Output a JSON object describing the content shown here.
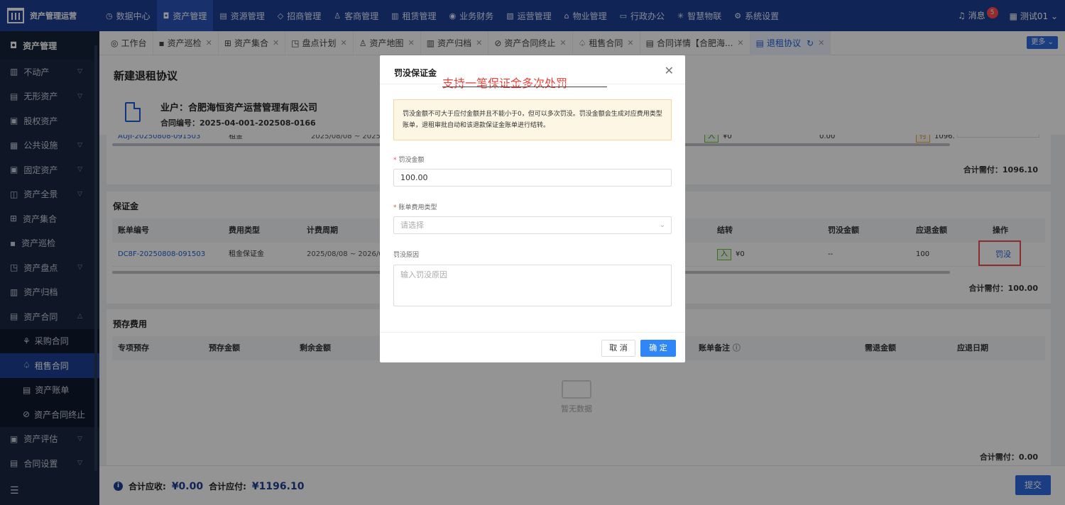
{
  "topbar": {
    "app_name": "资产管理运营",
    "nav": [
      {
        "label": "数据中心",
        "icon": "clock-icon"
      },
      {
        "label": "资产管理",
        "icon": "cube-icon"
      },
      {
        "label": "资源管理",
        "icon": "file-icon"
      },
      {
        "label": "招商管理",
        "icon": "diamond-icon"
      },
      {
        "label": "客商管理",
        "icon": "people-icon"
      },
      {
        "label": "租赁管理",
        "icon": "building-icon"
      },
      {
        "label": "业务财务",
        "icon": "money-icon"
      },
      {
        "label": "运营管理",
        "icon": "chart-icon"
      },
      {
        "label": "物业管理",
        "icon": "house-icon"
      },
      {
        "label": "行政办公",
        "icon": "monitor-icon"
      },
      {
        "label": "智慧物联",
        "icon": "iot-icon"
      },
      {
        "label": "系统设置",
        "icon": "gear-icon"
      }
    ],
    "messages_label": "消息",
    "messages_count": "5",
    "user": "测试01"
  },
  "sidebar": {
    "header": "资产管理",
    "items": [
      {
        "label": "不动产"
      },
      {
        "label": "无形资产"
      },
      {
        "label": "股权资产"
      },
      {
        "label": "公共设施"
      },
      {
        "label": "固定资产"
      },
      {
        "label": "资产全景"
      },
      {
        "label": "资产集合"
      },
      {
        "label": "资产巡检"
      },
      {
        "label": "资产盘点"
      },
      {
        "label": "资产归档"
      },
      {
        "label": "资产合同"
      }
    ],
    "sub_items": [
      {
        "label": "采购合同"
      },
      {
        "label": "租售合同"
      },
      {
        "label": "资产账单"
      },
      {
        "label": "资产合同终止"
      }
    ],
    "after_items": [
      {
        "label": "资产评估"
      },
      {
        "label": "合同设置"
      }
    ]
  },
  "tabs": [
    {
      "label": "工作台"
    },
    {
      "label": "资产巡检"
    },
    {
      "label": "资产集合"
    },
    {
      "label": "盘点计划"
    },
    {
      "label": "资产地图"
    },
    {
      "label": "资产归档"
    },
    {
      "label": "资产合同终止"
    },
    {
      "label": "租售合同"
    },
    {
      "label": "合同详情【合肥海..."
    },
    {
      "label": "退租协议"
    }
  ],
  "more_label": "更多",
  "page": {
    "title": "新建退租协议",
    "owner": "业户：合肥海恒资产运营管理有限公司",
    "contract_no": "合同编号：2025-04-001-202508-0166"
  },
  "rent_partial": {
    "bill_no": "AUJI-20250808-091503",
    "fee_type": "租金",
    "period": "2025/08/08 ~ 2025/1",
    "carry": "¥0",
    "amount": "0.00",
    "tag": "付",
    "due_partial": "1096.",
    "date": "2025-08-08",
    "total": "合计需付：1096.10"
  },
  "deposit": {
    "title": "保证金",
    "headers": [
      "账单编号",
      "费用类型",
      "计费周期",
      "结转",
      "罚没金额",
      "应退金额",
      "操作"
    ],
    "row": {
      "bill_no": "DC8F-20250808-091503",
      "fee_type": "租金保证金",
      "period": "2025/08/08 ~ 2026/08/07",
      "carry_tag": "入",
      "carry": "¥0",
      "forfeit": "--",
      "refund": "100",
      "action": "罚没"
    },
    "total": "合计需付：100.00"
  },
  "prestore": {
    "title": "预存费用",
    "headers": [
      "专项预存",
      "预存金额",
      "剩余金额",
      "账单备注",
      "需退金额",
      "应退日期"
    ],
    "empty": "暂无数据",
    "total": "合计需付：0.00"
  },
  "footer": {
    "receivable_label": "合计应收:",
    "receivable": "¥0.00",
    "payable_label": "合计应付:",
    "payable": "¥1196.10",
    "submit": "提交"
  },
  "modal": {
    "title": "罚没保证金",
    "annotation": "支持一笔保证金多次处罚",
    "notice": "罚没金额不可大于应付金额并且不能小于0，但可以多次罚没。罚没金额会生成对应费用类型账单，退租审批自动和该退款保证金账单进行结转。",
    "amount_label": "罚没金额",
    "amount_value": "100.00",
    "type_label": "账单费用类型",
    "type_placeholder": "请选择",
    "reason_label": "罚没原因",
    "reason_placeholder": "输入罚没原因",
    "cancel": "取 消",
    "ok": "确 定"
  }
}
